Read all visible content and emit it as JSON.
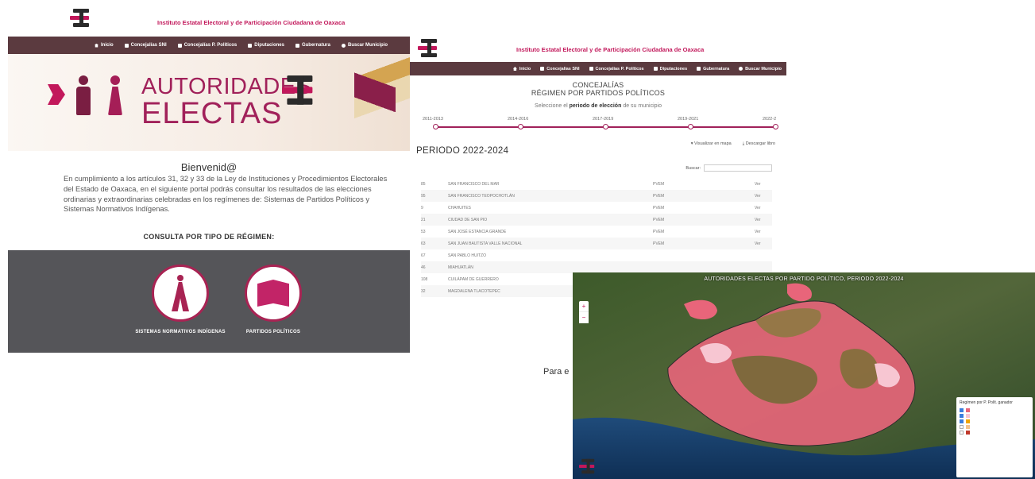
{
  "institute": "Instituto Estatal Electoral y de Participación Ciudadana de Oaxaca",
  "nav": [
    "Inicio",
    "Concejalías SNI",
    "Concejalías P. Políticos",
    "Diputaciones",
    "Gubernatura",
    "Buscar Municipio"
  ],
  "home": {
    "banner_line1": "AUTORIDADES",
    "banner_line2": "ELECTAS",
    "welcome": "Bienvenid@",
    "intro": "En cumplimiento a los artículos 31, 32 y 33 de la Ley de Instituciones y Procedimientos Electorales del Estado de Oaxaca, en el siguiente portal podrás consultar los resultados de las elecciones ordinarias y extraordinarias celebradas en los regímenes de: Sistemas de Partidos Políticos y Sistemas Normativos Indígenas.",
    "consulta": "CONSULTA POR TIPO DE RÉGIMEN:",
    "regimes": [
      "SISTEMAS NORMATIVOS INDÍGENAS",
      "PARTIDOS POLÍTICOS"
    ]
  },
  "concejalias": {
    "title": "CONCEJALÍAS",
    "subtitle": "RÉGIMEN POR PARTIDOS POLÍTICOS",
    "select_prefix": "Seleccione el",
    "select_bold": "periodo de elección",
    "select_suffix": "de su municipio",
    "periods": [
      "2011-2013",
      "2014-2016",
      "2017-2019",
      "2019-2021",
      "2022-2"
    ],
    "period_heading": "PERIODO 2022-2024",
    "action_map": "Visualizar en mapa",
    "action_download": "Descargar libro",
    "search_label": "Buscar:",
    "table_rows": [
      {
        "num": "85",
        "muni": "SAN FRANCISCO DEL MAR",
        "party": "PVEM",
        "see": "Ver"
      },
      {
        "num": "95",
        "muni": "SAN FRANCISCO TEOPOCHOTLÁN",
        "party": "PVEM",
        "see": "Ver"
      },
      {
        "num": "9",
        "muni": "CHAHUITES",
        "party": "PVEM",
        "see": "Ver"
      },
      {
        "num": "21",
        "muni": "CIUDAD DE SAN PIO",
        "party": "PVEM",
        "see": "Ver"
      },
      {
        "num": "53",
        "muni": "SAN JOSÉ ESTANCIA GRANDE",
        "party": "PVEM",
        "see": "Ver"
      },
      {
        "num": "63",
        "muni": "SAN JUAN BAUTISTA VALLE NACIONAL",
        "party": "PVEM",
        "see": "Ver"
      },
      {
        "num": "67",
        "muni": "SAN PABLO HUITZO",
        "party": "",
        "see": ""
      },
      {
        "num": "46",
        "muni": "MIAHUATLÁN",
        "party": "",
        "see": ""
      },
      {
        "num": "108",
        "muni": "CUILÁPAM DE GUERRERO",
        "party": "",
        "see": ""
      },
      {
        "num": "32",
        "muni": "MAGDALENA TLACOTEPEC",
        "party": "",
        "see": ""
      }
    ],
    "para_label": "Para e"
  },
  "map": {
    "title": "AUTORIDADES ELECTAS POR PARTIDO POLÍTICO, PERIODO 2022-2024",
    "zoom_in": "+",
    "zoom_out": "−",
    "legend_title": "Regímen por P. Polít. ganador"
  },
  "colors": {
    "brand": "#c2185b",
    "nav_bg": "#5b3a3f",
    "dark_panel": "#555559",
    "map_pink": "#e8657a",
    "map_light_pink": "#f7c6d2"
  }
}
